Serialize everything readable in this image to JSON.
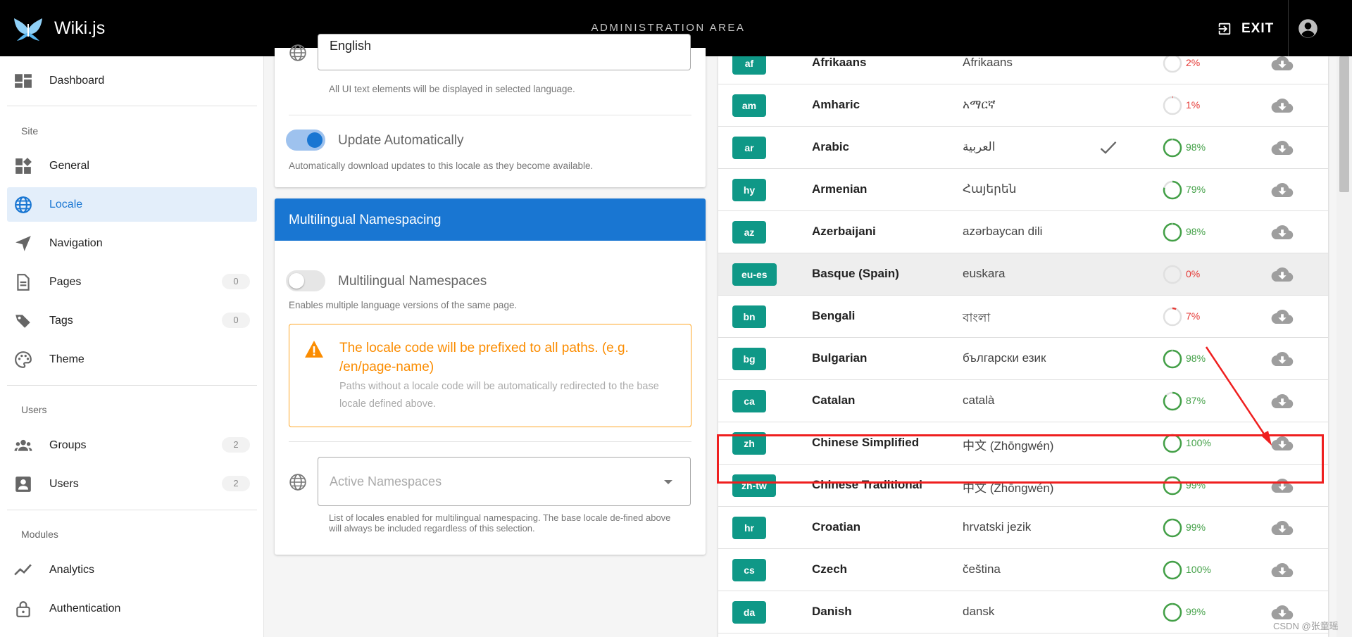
{
  "header": {
    "brand": "Wiki.js",
    "title": "ADMINISTRATION AREA",
    "exit_label": "EXIT"
  },
  "sidebar": {
    "dashboard": "Dashboard",
    "sections": {
      "site": "Site",
      "users": "Users",
      "modules": "Modules"
    },
    "site_items": [
      {
        "label": "General",
        "icon": "dashboard-grid-icon"
      },
      {
        "label": "Locale",
        "icon": "globe-icon",
        "active": true
      },
      {
        "label": "Navigation",
        "icon": "navigation-arrow-icon"
      },
      {
        "label": "Pages",
        "count": "0",
        "icon": "document-icon"
      },
      {
        "label": "Tags",
        "count": "0",
        "icon": "tags-icon"
      },
      {
        "label": "Theme",
        "icon": "palette-icon"
      }
    ],
    "user_items": [
      {
        "label": "Groups",
        "count": "2",
        "icon": "groups-icon"
      },
      {
        "label": "Users",
        "count": "2",
        "icon": "user-box-icon"
      }
    ],
    "module_items": [
      {
        "label": "Analytics",
        "icon": "chart-line-icon"
      },
      {
        "label": "Authentication",
        "icon": "lock-icon"
      }
    ]
  },
  "locale_settings": {
    "site_locale_value": "English",
    "site_locale_hint": "All UI text elements will be displayed in selected language.",
    "auto_update": {
      "label": "Update Automatically",
      "enabled": true,
      "hint": "Automatically download updates to this locale as they become available."
    }
  },
  "namespacing": {
    "title": "Multilingual Namespacing",
    "toggle_label": "Multilingual Namespaces",
    "toggle_enabled": false,
    "toggle_hint": "Enables multiple language versions of the same page.",
    "alert_title": "The locale code will be prefixed to all paths. (e.g. /en/page-name)",
    "alert_text": "Paths without a locale code will be automatically redirected to the base locale defined above.",
    "active_placeholder": "Active Namespaces",
    "active_hint": "List of locales enabled for multilingual namespacing. The base locale de-fined above will always be included regardless of this selection."
  },
  "locales": [
    {
      "code": "af",
      "name": "Afrikaans",
      "native": "Afrikaans",
      "progress": 2,
      "pct": "2%",
      "status": "low",
      "rtl": false
    },
    {
      "code": "am",
      "name": "Amharic",
      "native": "አማርኛ",
      "progress": 1,
      "pct": "1%",
      "status": "low",
      "rtl": false
    },
    {
      "code": "ar",
      "name": "Arabic",
      "native": "العربية",
      "progress": 98,
      "pct": "98%",
      "status": "ok",
      "rtl": true
    },
    {
      "code": "hy",
      "name": "Armenian",
      "native": "Հայերեն",
      "progress": 79,
      "pct": "79%",
      "status": "ok",
      "rtl": false
    },
    {
      "code": "az",
      "name": "Azerbaijani",
      "native": "azərbaycan dili",
      "progress": 98,
      "pct": "98%",
      "status": "ok",
      "rtl": false
    },
    {
      "code": "eu-es",
      "name": "Basque (Spain)",
      "native": "euskara",
      "progress": 0,
      "pct": "0%",
      "status": "low",
      "rtl": false,
      "hovered": true
    },
    {
      "code": "bn",
      "name": "Bengali",
      "native": "বাংলা",
      "progress": 7,
      "pct": "7%",
      "status": "low",
      "rtl": false
    },
    {
      "code": "bg",
      "name": "Bulgarian",
      "native": "български език",
      "progress": 98,
      "pct": "98%",
      "status": "ok",
      "rtl": false
    },
    {
      "code": "ca",
      "name": "Catalan",
      "native": "català",
      "progress": 87,
      "pct": "87%",
      "status": "ok",
      "rtl": false
    },
    {
      "code": "zh",
      "name": "Chinese Simplified",
      "native": "中文 (Zhōngwén)",
      "progress": 100,
      "pct": "100%",
      "status": "ok",
      "rtl": false
    },
    {
      "code": "zh-tw",
      "name": "Chinese Traditional",
      "native": "中文 (Zhōngwén)",
      "progress": 99,
      "pct": "99%",
      "status": "ok",
      "rtl": false
    },
    {
      "code": "hr",
      "name": "Croatian",
      "native": "hrvatski jezik",
      "progress": 99,
      "pct": "99%",
      "status": "ok",
      "rtl": false
    },
    {
      "code": "cs",
      "name": "Czech",
      "native": "čeština",
      "progress": 100,
      "pct": "100%",
      "status": "ok",
      "rtl": false
    },
    {
      "code": "da",
      "name": "Danish",
      "native": "dansk",
      "progress": 99,
      "pct": "99%",
      "status": "ok",
      "rtl": false
    }
  ],
  "colors": {
    "accent": "#1976d2",
    "chip": "#0f9887",
    "progress_ok": "#43a047",
    "progress_low": "#e53935",
    "annotation": "#ef1f1f"
  },
  "watermark": "CSDN @张童瑶"
}
